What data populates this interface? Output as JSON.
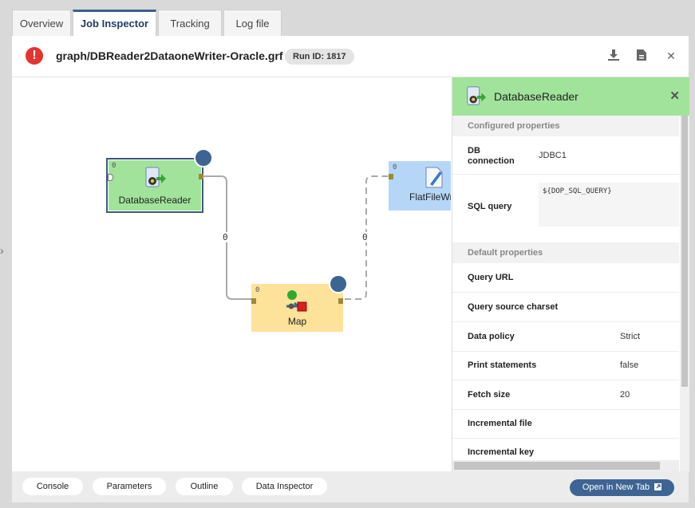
{
  "tabs": [
    {
      "label": "Overview"
    },
    {
      "label": "Job Inspector"
    },
    {
      "label": "Tracking"
    },
    {
      "label": "Log file"
    }
  ],
  "header": {
    "error_glyph": "!",
    "graph_path": "graph/DBReader2DataoneWriter-Oracle.grf",
    "run_id": "Run ID: 1817"
  },
  "graph": {
    "nodes": {
      "reader": {
        "label": "DatabaseReader",
        "port_index": "0"
      },
      "map": {
        "label": "Map",
        "port_index": "0"
      },
      "writer": {
        "label": "FlatFileWri",
        "port_index": "0"
      }
    },
    "edges": {
      "reader_map": "0",
      "map_writer": "0"
    }
  },
  "inspector": {
    "title": "DatabaseReader",
    "configured_heading": "Configured properties",
    "configured": {
      "db_connection_key": "DB connection",
      "db_connection_value": "JDBC1",
      "sql_query_key": "SQL query",
      "sql_query_value": "${DOP_SQL_QUERY}"
    },
    "default_heading": "Default properties",
    "defaults": [
      {
        "key": "Query URL",
        "value": ""
      },
      {
        "key": "Query source charset",
        "value": ""
      },
      {
        "key": "Data policy",
        "value": "Strict"
      },
      {
        "key": "Print statements",
        "value": "false"
      },
      {
        "key": "Fetch size",
        "value": "20"
      },
      {
        "key": "Incremental file",
        "value": ""
      },
      {
        "key": "Incremental key",
        "value": ""
      }
    ]
  },
  "footer": {
    "buttons": [
      "Console",
      "Parameters",
      "Outline",
      "Data Inspector"
    ],
    "open_tab": "Open in New Tab"
  },
  "colors": {
    "accent": "#3e6494",
    "reader_bg": "#a1e39b",
    "map_bg": "#fde29a",
    "writer_bg": "#b6d6f8",
    "error": "#e3342f"
  }
}
